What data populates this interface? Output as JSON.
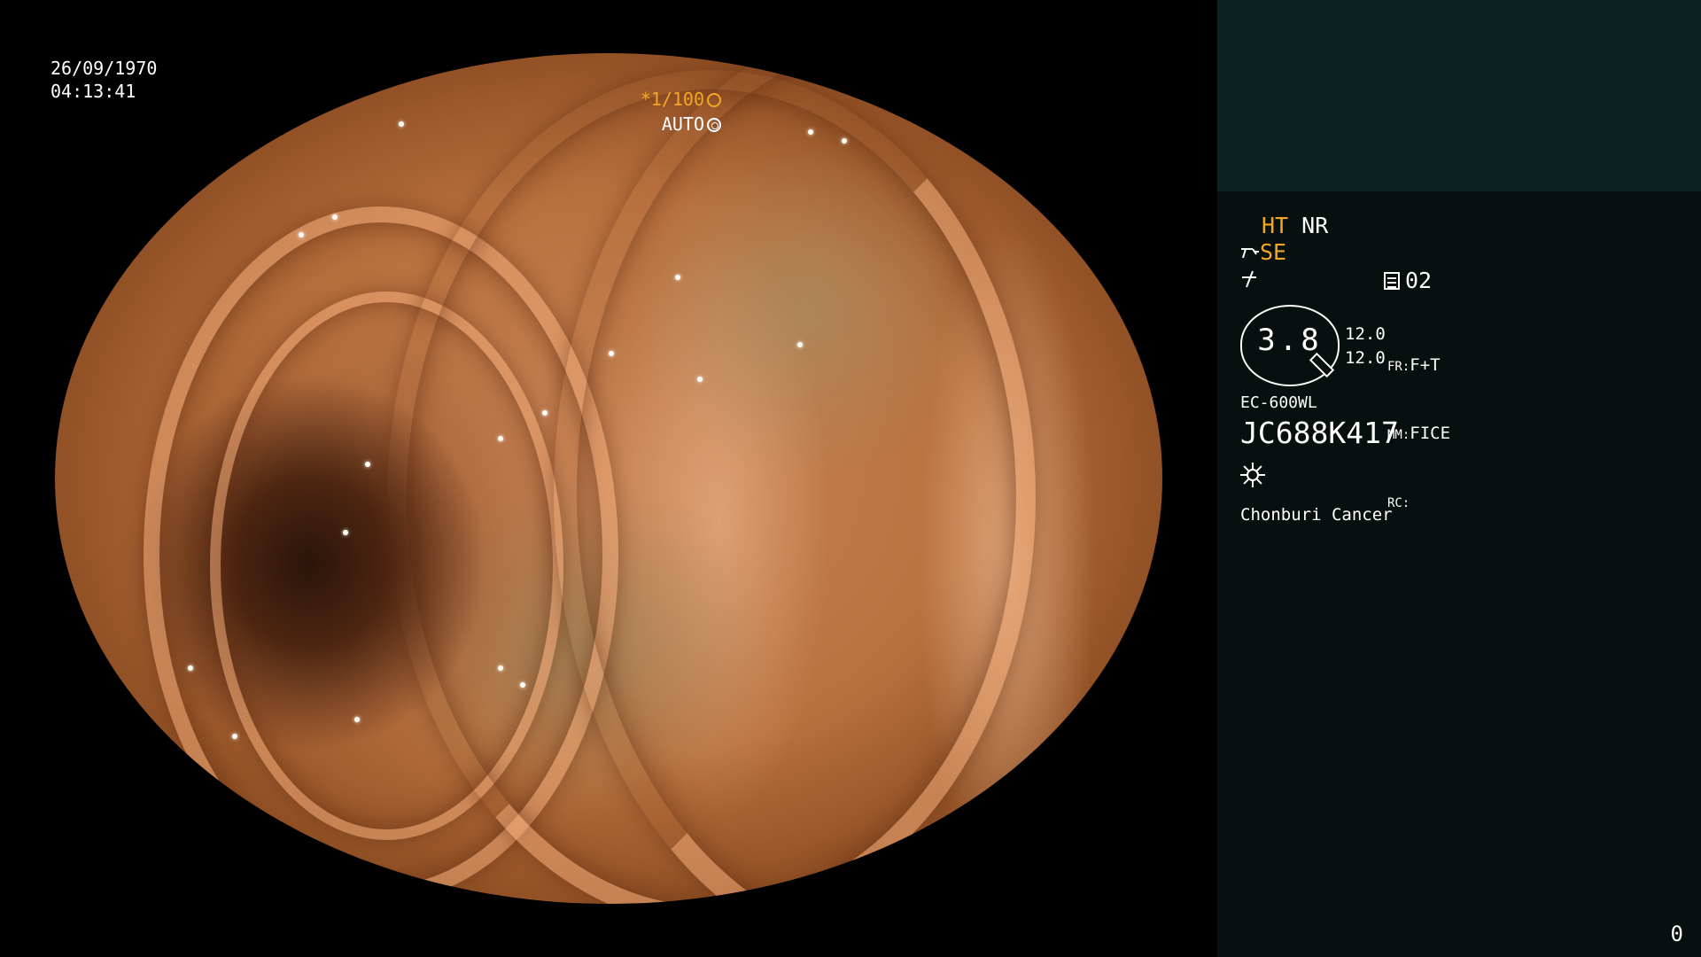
{
  "overlay": {
    "date": "26/09/1970",
    "time": "04:13:41",
    "shutter": "*1/100",
    "exposure_mode": "AUTO"
  },
  "panel": {
    "modes": {
      "ht": "HT",
      "nr": "NR",
      "se": "SE"
    },
    "preset": "02",
    "dial": {
      "value": "3.8",
      "line1": "12.0",
      "line2": "12.0"
    },
    "settings": {
      "fr_label": "FR:",
      "fr_value": "F+T",
      "mm_label": "MM:",
      "mm_value": "FICE",
      "rc_label": "RC:",
      "rc_value": ""
    },
    "scope_model": "EC-600WL",
    "serial": "JC688K417",
    "hospital": "Chonburi Cancer",
    "page_counter": "0"
  },
  "colors": {
    "amber": "#f5a623",
    "panel_bg": "#07100f",
    "panel_header_bg": "#0c2222"
  }
}
